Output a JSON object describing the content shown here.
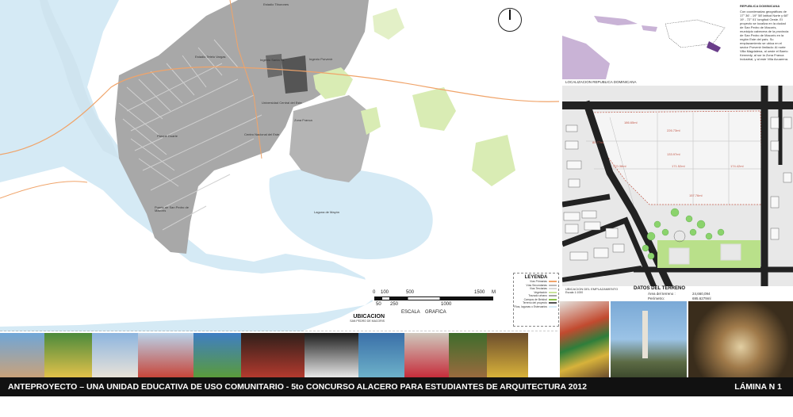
{
  "map": {
    "labels": [
      "Estadio Tetelo Vargas",
      "Estadio Tiburones",
      "Ingenio Porvenir",
      "Ingenio Santa Fe",
      "Universidad Central del Este",
      "Centro Nacional del Este",
      "Parque Duarte",
      "Zona Franca",
      "Puerto de San Pedro de Macorís",
      "Laguna de Mayón"
    ],
    "north_arrow": "north-arrow",
    "legend": {
      "title": "LEYENDA",
      "items": [
        {
          "label": "Vías Primarias",
          "color": "#f0a46a"
        },
        {
          "label": "Vías Secundarias",
          "color": "#b9b9b9"
        },
        {
          "label": "Vías Terciarias",
          "color": "#d8d8d8"
        },
        {
          "label": "Vegetación",
          "color": "#c8e39a"
        },
        {
          "label": "Trazado urbano",
          "color": "#a8a8a8"
        },
        {
          "label": "Campos de Beisbol",
          "color": "#8bc34a"
        },
        {
          "label": "Terreno del proyecto",
          "color": "#555555"
        },
        {
          "label": "Ríos, lagunas o Esteruarios",
          "color": "#d5eaf5"
        }
      ]
    },
    "scale": {
      "ticks_top": [
        "0",
        "100",
        "500",
        "1500",
        "M"
      ],
      "ticks_bottom": [
        "50",
        "250",
        "1000"
      ],
      "caption": "ESCALA    GRAFICA"
    },
    "ubicacion": {
      "title": "UBICACION",
      "subtitle": "SAN PEDRO DE MACORIS"
    }
  },
  "right": {
    "country_title": "REPUBLICA DOMINICANA",
    "text": "Con coordenadas geográficas de 17° 36' - 19° 58' latitud Norte y 68° 19' - 72° 01' longitud Oeste. El proyecto se localiza en la ciudad de San Pedro de Macorís, municipio cabecera de la provincia de San Pedro de Macorís en la región Este del país. Su emplazamiento se ubica en el sector Porvenir limitado: Al norte Villa Magdalena, al oeste el Barrio Kennedy, al sur la Zona Franca Industrial, y al este Villa Acuarena.",
    "map_caption": "LOCALIZACION REPUBLICA DOMINICANA",
    "plan_caption": "UBICACION DEL EMPLAZAMIENTO",
    "plan_scale": "Escala 1:1000",
    "datos_title": "DATOS DEL TERRENO",
    "area_label": "Área del terreno :",
    "area_value": "24,660,094",
    "perim_label": "Perímetro:",
    "perim_value": "695.6279ml",
    "dims": [
      "186.65ml",
      "226.73ml",
      "80.77ml",
      "133.97ml",
      "170.38ml",
      "171.52ml",
      "174.42ml",
      "157.76ml"
    ]
  },
  "photos": [
    {
      "name": "church-photo",
      "c1": "#6fa6d8",
      "c2": "#c9a27a"
    },
    {
      "name": "park-photo",
      "c1": "#4b8a3c",
      "c2": "#e2c14a"
    },
    {
      "name": "white-building-photo",
      "c1": "#8db5df",
      "c2": "#e8e2d8"
    },
    {
      "name": "red-building-photo",
      "c1": "#b9d3ea",
      "c2": "#c7463a"
    },
    {
      "name": "palm-photo",
      "c1": "#3f7ec4",
      "c2": "#5a9b3b"
    },
    {
      "name": "dancers-photo",
      "c1": "#2f1f1a",
      "c2": "#b33a2e"
    },
    {
      "name": "bird-photo",
      "c1": "#1c1c1c",
      "c2": "#e7e7e7"
    },
    {
      "name": "boats-photo",
      "c1": "#3a6fa8",
      "c2": "#6db1c9"
    },
    {
      "name": "costume-photo",
      "c1": "#cfc8bd",
      "c2": "#c62d3b"
    },
    {
      "name": "sugarcane-photo",
      "c1": "#3e6c2c",
      "c2": "#9a6b3e"
    },
    {
      "name": "masked-dancer-photo",
      "c1": "#6b4d2d",
      "c2": "#d9b23a"
    },
    {
      "name": "mill-chimney-photo",
      "c1": "#7aa9d6",
      "c2": "#4f5b3a"
    },
    {
      "name": "crab-photo",
      "c1": "#3a2d1c",
      "c2": "#e0cba0"
    }
  ],
  "footer": {
    "title": "ANTEPROYECTO – UNA UNIDAD EDUCATIVA DE USO COMUNITARIO - 5to CONCURSO ALACERO PARA ESTUDIANTES DE ARQUITECTURA 2012",
    "sheet": "LÁMINA N  1"
  },
  "colors": {
    "water": "#d5eaf5",
    "urban": "#a8a8a8",
    "vegetation": "#d9ecb4",
    "primary_road": "#f0a46a",
    "site": "#555555"
  }
}
